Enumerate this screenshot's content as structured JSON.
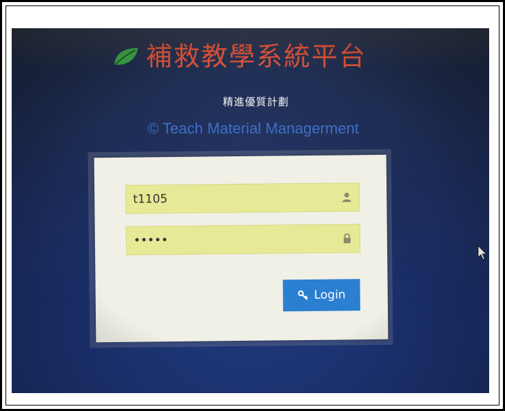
{
  "app": {
    "title": "補救教學系統平台",
    "subtitle": "精進優質計劃",
    "copyright": "© Teach Material Managerment"
  },
  "login_form": {
    "username_value": "t1105",
    "password_value": "•••••",
    "login_label": "Login"
  },
  "icons": {
    "logo": "leaf-icon",
    "username": "user-icon",
    "password": "lock-icon",
    "login": "key-icon",
    "pointer": "mouse-cursor-icon"
  },
  "colors": {
    "title": "#e0533a",
    "copyright": "#3e6fc6",
    "field_bg": "#e6ea96",
    "button": "#2a7fd0",
    "panel": "#f1f0e6"
  }
}
